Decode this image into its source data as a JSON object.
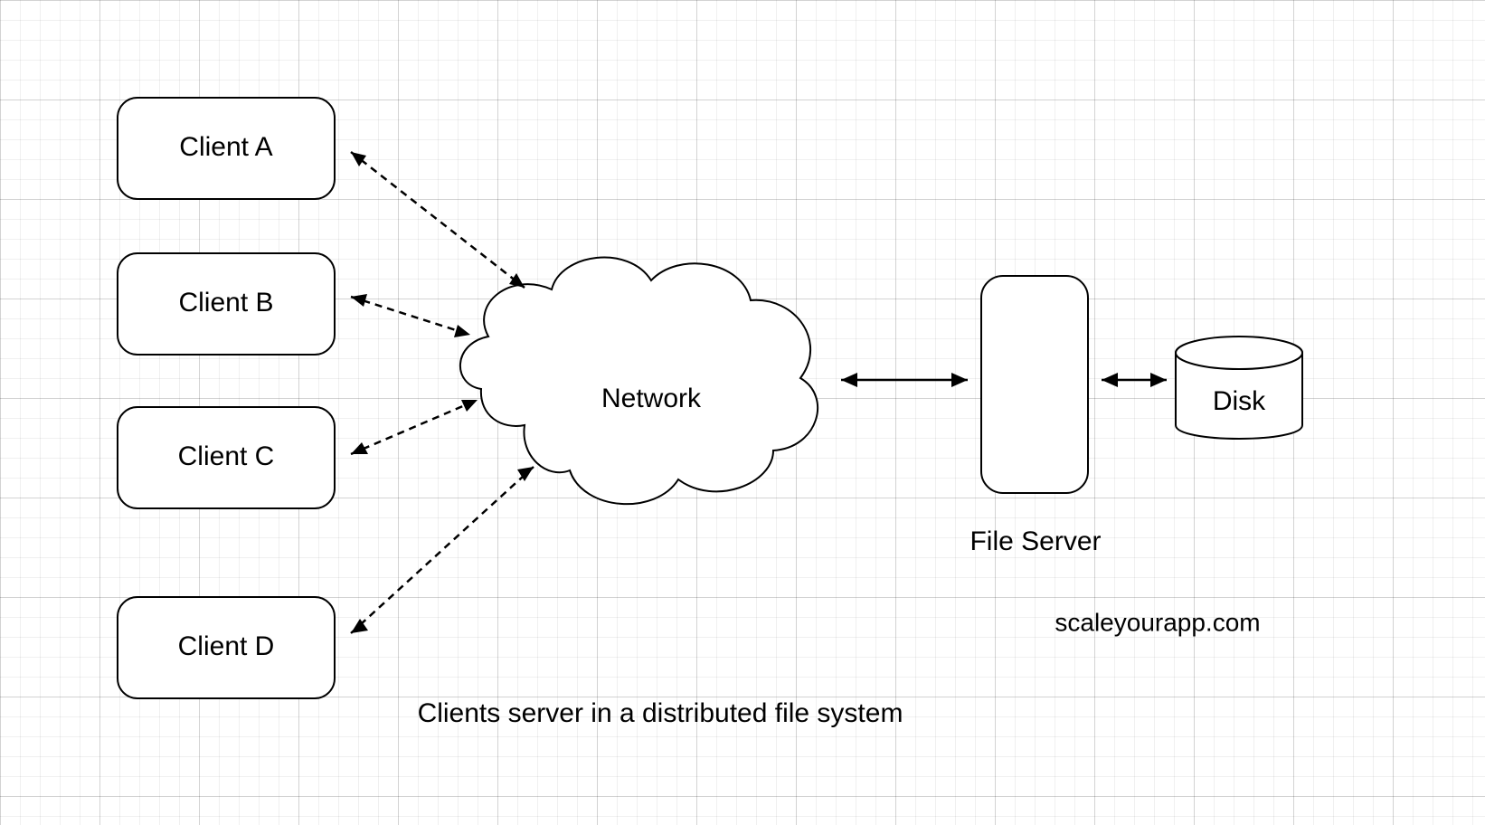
{
  "clients": [
    {
      "label": "Client A"
    },
    {
      "label": "Client B"
    },
    {
      "label": "Client C"
    },
    {
      "label": "Client D"
    }
  ],
  "network_label": "Network",
  "file_server_label": "File Server",
  "disk_label": "Disk",
  "caption": "Clients server in a distributed file system",
  "attribution": "scaleyourapp.com"
}
